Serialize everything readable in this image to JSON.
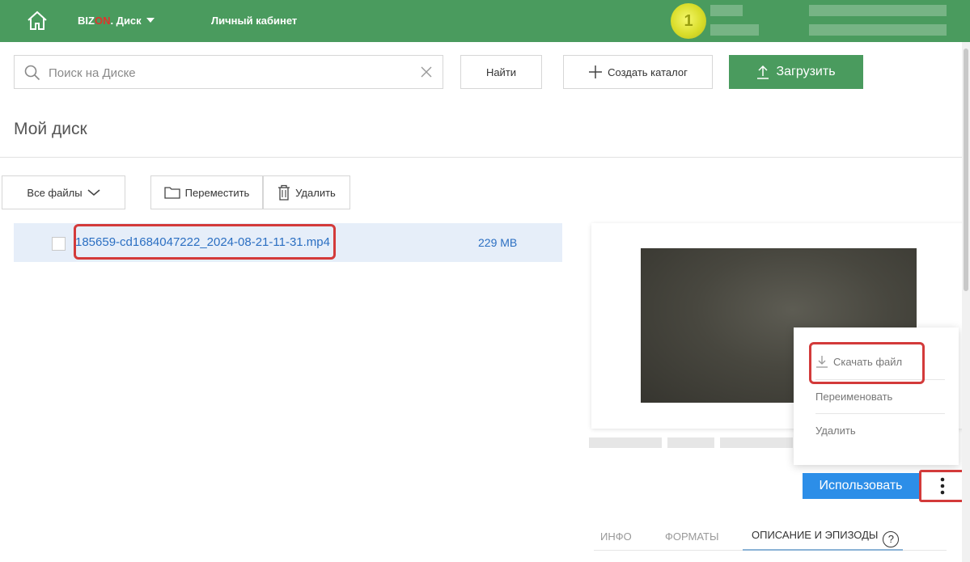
{
  "header": {
    "brand_part1": "BIZ",
    "brand_part2": "ON",
    "brand_part3": ". Диск",
    "cabinet_link": "Личный кабинет",
    "balance_badge": "1",
    "colors": {
      "bar": "#4a9b5e",
      "brand_accent": "#e0332b"
    }
  },
  "toolbar": {
    "search_placeholder": "Поиск на Диске",
    "find_label": "Найти",
    "create_folder_label": "Создать каталог",
    "upload_label": "Загрузить"
  },
  "page": {
    "title": "Мой диск"
  },
  "actions": {
    "filter_label": "Все файлы",
    "move_label": "Переместить",
    "delete_label": "Удалить"
  },
  "files": [
    {
      "name": "185659-cd1684047222_2024-08-21-11-31.mp4",
      "size": "229 MB",
      "selected": true
    }
  ],
  "preview": {
    "use_label": "Использовать",
    "menu": {
      "download": "Скачать файл",
      "rename": "Переименовать",
      "delete": "Удалить"
    },
    "tabs": [
      "ИНФО",
      "ФОРМАТЫ",
      "ОПИСАНИЕ И ЭПИЗОДЫ"
    ],
    "active_tab": "ОПИСАНИЕ И ЭПИЗОДЫ",
    "help_symbol": "?"
  },
  "icons": [
    "home-icon",
    "chevron-down-icon",
    "search-icon",
    "close-icon",
    "plus-icon",
    "upload-icon",
    "folder-icon",
    "trash-icon",
    "download-icon",
    "more-vertical-icon",
    "help-icon"
  ]
}
